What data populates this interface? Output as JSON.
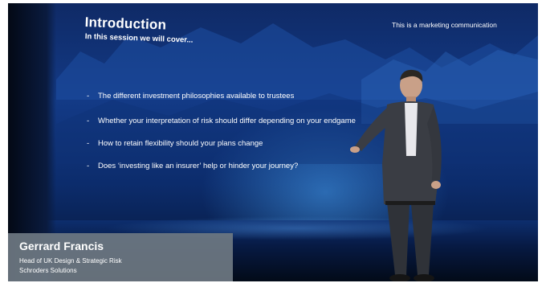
{
  "slide": {
    "title": "Introduction",
    "subtitle": "In this session we will cover...",
    "disclaimer": "This is a marketing communication",
    "bullets": [
      "The different investment philosophies available to trustees",
      "Whether your interpretation of risk should differ depending on your endgame",
      "How to retain flexibility should your plans change",
      "Does ‘investing like an insurer’ help or hinder your journey?"
    ],
    "bullet_marker": "-"
  },
  "speaker": {
    "name": "Gerrard Francis",
    "role": "Head of UK Design & Strategic Risk",
    "organization": "Schroders Solutions"
  },
  "colors": {
    "background_blue": "#133a86",
    "lower_third": "#6e7882",
    "text": "#ffffff"
  }
}
